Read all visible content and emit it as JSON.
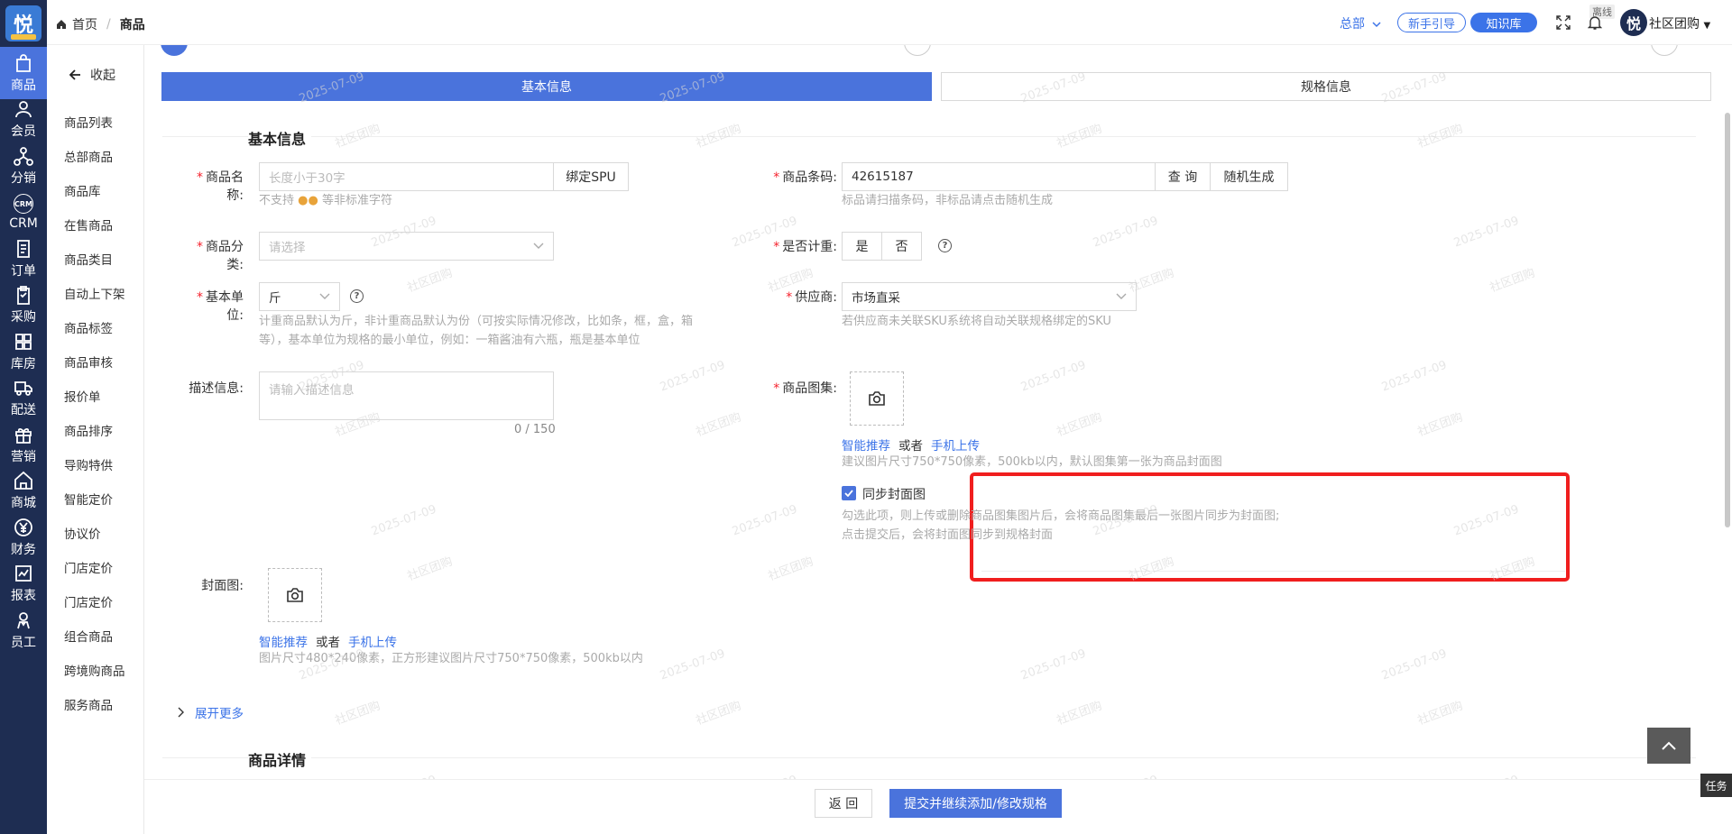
{
  "rail": {
    "logo": "悦",
    "items": [
      {
        "label": "商品",
        "icon": "bag-icon",
        "active": true
      },
      {
        "label": "会员",
        "icon": "user-icon"
      },
      {
        "label": "分销",
        "icon": "network-icon"
      },
      {
        "label": "CRM",
        "icon": "crm-icon"
      },
      {
        "label": "订单",
        "icon": "order-icon"
      },
      {
        "label": "采购",
        "icon": "clipboard-icon"
      },
      {
        "label": "库房",
        "icon": "warehouse-icon"
      },
      {
        "label": "配送",
        "icon": "truck-icon"
      },
      {
        "label": "营销",
        "icon": "gift-icon"
      },
      {
        "label": "商城",
        "icon": "home-icon"
      },
      {
        "label": "财务",
        "icon": "yen-icon"
      },
      {
        "label": "报表",
        "icon": "chart-icon"
      },
      {
        "label": "员工",
        "icon": "staff-icon"
      }
    ]
  },
  "submenu": {
    "collapse": "收起",
    "items": [
      "商品列表",
      "总部商品",
      "商品库",
      "在售商品",
      "商品类目",
      "自动上下架",
      "商品标签",
      "商品审核",
      "报价单",
      "商品排序",
      "导购特供",
      "智能定价",
      "协议价",
      "门店定价",
      "门店定价",
      "组合商品",
      "跨境购商品",
      "服务商品"
    ]
  },
  "header": {
    "home": "首页",
    "current": "商品",
    "hq": "总部",
    "guide": "新手引导",
    "knowledge": "知识库",
    "offline": "离线",
    "avatar": "悦",
    "account": "社区团购"
  },
  "tabs": {
    "basic": "基本信息",
    "spec": "规格信息"
  },
  "section": {
    "basic": "基本信息",
    "detail": "商品详情"
  },
  "form": {
    "name_label": "商品名称:",
    "name_placeholder": "长度小于30字",
    "bind_spu": "绑定SPU",
    "name_hint_pre": "不支持",
    "name_hint_post": "等非标准字符",
    "barcode_label": "商品条码:",
    "barcode_value": "42615187",
    "query": "查 询",
    "random": "随机生成",
    "barcode_hint": "标品请扫描条码，非标品请点击随机生成",
    "category_label": "商品分类:",
    "category_placeholder": "请选择",
    "weighed_label": "是否计重:",
    "yes": "是",
    "no": "否",
    "unit_label": "基本单位:",
    "unit_value": "斤",
    "unit_hint1": "计重商品默认为斤，非计重商品默认为份（可按实际情况修改，比如条，框，盒，箱",
    "unit_hint2": "等），基本单位为规格的最小单位，例如：一箱酱油有六瓶，瓶是基本单位",
    "supplier_label": "供应商:",
    "supplier_value": "市场直采",
    "supplier_hint": "若供应商未关联SKU系统将自动关联规格绑定的SKU",
    "desc_label": "描述信息:",
    "desc_placeholder": "请输入描述信息",
    "desc_count": "0 / 150",
    "gallery_label": "商品图集:",
    "smart": "智能推荐",
    "or": "或者",
    "mobile": "手机上传",
    "gallery_hint": "建议图片尺寸750*750像素，500kb以内，默认图集第一张为商品封面图",
    "sync_label": "同步封面图",
    "sync_hint1": "勾选此项，则上传或删除商品图集图片后，会将商品图集最后一张图片同步为封面图;",
    "sync_hint2": "点击提交后，会将封面图同步到规格封面",
    "cover_label": "封面图:",
    "cover_hint": "图片尺寸480*240像素，正方形建议图片尺寸750*750像素，500kb以内",
    "expand_more": "展开更多"
  },
  "footer": {
    "back": "返 回",
    "submit": "提交并继续添加/修改规格"
  },
  "task": "任务",
  "watermark": {
    "date": "2025-07-09",
    "name": "社区团购"
  }
}
